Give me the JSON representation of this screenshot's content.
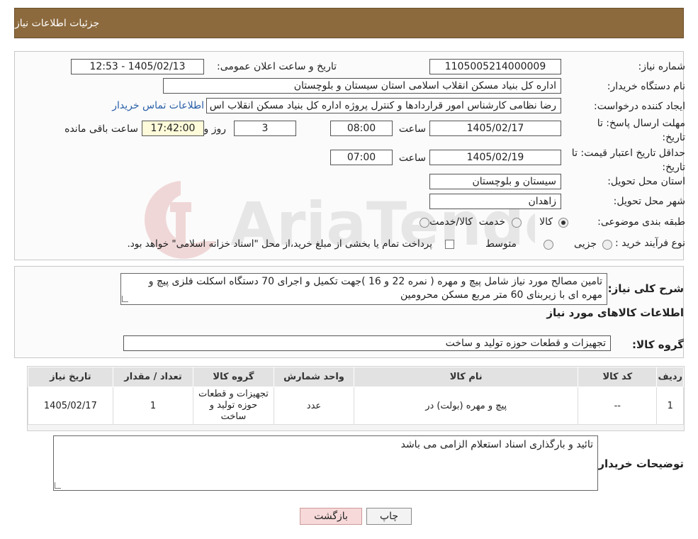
{
  "header": {
    "title": "جزئیات اطلاعات نیاز"
  },
  "details": {
    "need_number_label": "شماره نیاز:",
    "need_number": "1105005214000009",
    "announce_label": "تاریخ و ساعت اعلان عمومی:",
    "announce_value": "1405/02/13 - 12:53",
    "buyer_org_label": "نام دستگاه خریدار:",
    "buyer_org": "اداره کل بنیاد مسکن انقلاب اسلامی استان سیستان و بلوچستان",
    "requester_label": "ایجاد کننده درخواست:",
    "requester": "رضا نظامی کارشناس امور قراردادها و کنترل پروژه اداره کل بنیاد مسکن انقلاب اس",
    "contact_link": "اطلاعات تماس خریدار",
    "deadline_label_1": "مهلت ارسال پاسخ: تا",
    "deadline_label_2": "تاریخ:",
    "deadline_date": "1405/02/17",
    "time_label": "ساعت",
    "deadline_time": "08:00",
    "days_value": "3",
    "days_label": "روز و",
    "remaining_time": "17:42:00",
    "remaining_label": "ساعت باقی مانده",
    "validity_label_1": "حداقل تاریخ اعتبار قیمت: تا",
    "validity_label_2": "تاریخ:",
    "validity_date": "1405/02/19",
    "validity_time_label": "ساعت",
    "validity_time": "07:00",
    "province_label": "استان محل تحویل:",
    "province": "سیستان و بلوچستان",
    "city_label": "شهر محل تحویل:",
    "city": "زاهدان",
    "category_label": "طبقه بندی موضوعی:",
    "category_options": [
      "کالا",
      "خدمت",
      "کالا/خدمت"
    ],
    "process_label": "نوع فرآیند خرید :",
    "process_options": [
      "جزیی",
      "متوسط"
    ],
    "payment_note": "پرداخت تمام یا بخشی از مبلغ خرید،از محل \"اسناد خزانه اسلامی\" خواهد بود."
  },
  "description": {
    "label": "شرح کلی نیاز:",
    "text": "تامین مصالح مورد نیاز شامل پیچ و مهره ( نمره 22 و 16 )جهت تکمیل و اجرای 70 دستگاه اسکلت فلزی پیچ و مهره ای با زیربنای 60 متر مربع  مسکن محرومین"
  },
  "goods": {
    "section_title": "اطلاعات کالاهای مورد نیاز",
    "group_label": "گروه کالا:",
    "group_value": "تجهیزات و قطعات حوزه تولید و ساخت",
    "columns": [
      "ردیف",
      "کد کالا",
      "نام کالا",
      "واحد شمارش",
      "گروه کالا",
      "تعداد / مقدار",
      "تاریخ نیاز"
    ],
    "rows": [
      [
        "1",
        "--",
        "پیچ و مهره (بولت) در",
        "عدد",
        "تجهیزات و قطعات حوزه تولید و ساخت",
        "1",
        "1405/02/17"
      ]
    ]
  },
  "buyer_notes": {
    "label": "توضیحات خریدار:",
    "text": "تائید و بارگذاری اسناد استعلام الزامی می باشد"
  },
  "buttons": {
    "print": "چاپ",
    "back": "بازگشت"
  },
  "colors": {
    "header_bg": "#8c6a3e",
    "back_button_bg": "#f7d9d9",
    "link": "#2a5fa8"
  }
}
